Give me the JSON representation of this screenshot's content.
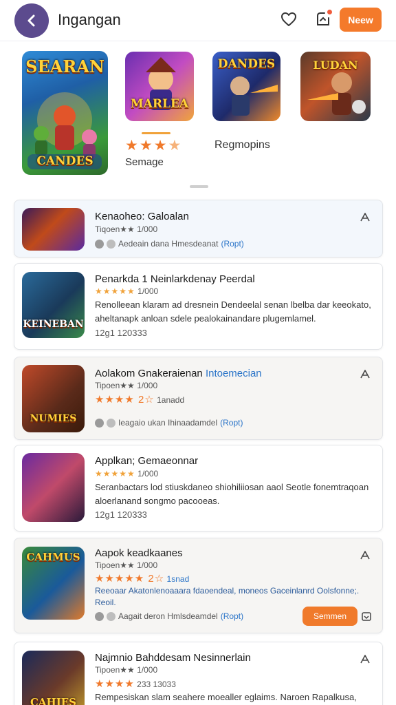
{
  "header": {
    "title": "Ingangan",
    "new_label": "Neew",
    "icons": [
      "back-arrow-icon",
      "heart-icon",
      "notification-icon"
    ]
  },
  "carousel": {
    "items": [
      {
        "logo": "SEARAN",
        "sub": "CANDES"
      },
      {
        "logo": "MARLEA",
        "sub": ""
      },
      {
        "logo": "DANDES",
        "sub": ""
      },
      {
        "logo": "LUDAN",
        "sub": ""
      }
    ],
    "rating": 3.5,
    "label": "Semage",
    "link": "Regmopins"
  },
  "list": [
    {
      "title": "Kenaoheo: Galoalan",
      "meta": "Tiqoen★★ 1/000",
      "footer_text": "Aedeain dana Hmesdeanat",
      "footer_link": "(Ropt)"
    },
    {
      "title": "Penarkda 1 Neinlarkdenay Peerdal",
      "meta": "1/000",
      "desc": "Renolleean klaram ad dresnein Dendeelal senan lbelba dar keeokato, aheltanapk anloan sdele pealokainandare plugemlamel.",
      "count": "12g1 120333"
    },
    {
      "title": "Aolakom Gnakeraienan",
      "title_accent": "Intoemecian",
      "meta": "Tipoen★★ 1/000",
      "meta2_stars": "★★★★ 2☆",
      "meta2": "1anadd",
      "footer_text": "Ieagaio ukan Ihinaadamdel",
      "footer_link": "(Ropt)"
    },
    {
      "title": "Applkan; Gemaeonnar",
      "meta": "1/000",
      "desc": "Seranbactars lod stiuskdaneo shiohiliiosan aaol Seotle fonemtraqoan aloerlanand songmo pacooeas.",
      "count": "12g1 120333"
    },
    {
      "title": "Aapok  keadkaanes",
      "meta": "Tipoen★★ 1/000",
      "meta2_stars": "★★★★★ 2☆",
      "meta2": "1snad",
      "desc": "Reeoaar Akatonlenoaaara fdaoendeal, moneos Gaceinlanrd Oolsfonne;. Reoil.",
      "footer_text": "Aagait deron Hmlsdeamdel",
      "footer_link": "(Ropt)",
      "button": "Semmen"
    },
    {
      "title": "Najmnio Bahddesam Nesinnerlain",
      "meta": "Tipoen★★ 1/000",
      "meta2_stars": "★★★★",
      "meta2": "233 13033",
      "desc": "Rempesiskan slam seahere moealler eglaims. Naroen Rapalkusa, aerlanand bgenaeloa pooeas."
    }
  ],
  "colors": {
    "accent": "#f47a2b",
    "back_button": "#5c4b8e",
    "link": "#2a74c8",
    "star": "#f0a23a"
  }
}
